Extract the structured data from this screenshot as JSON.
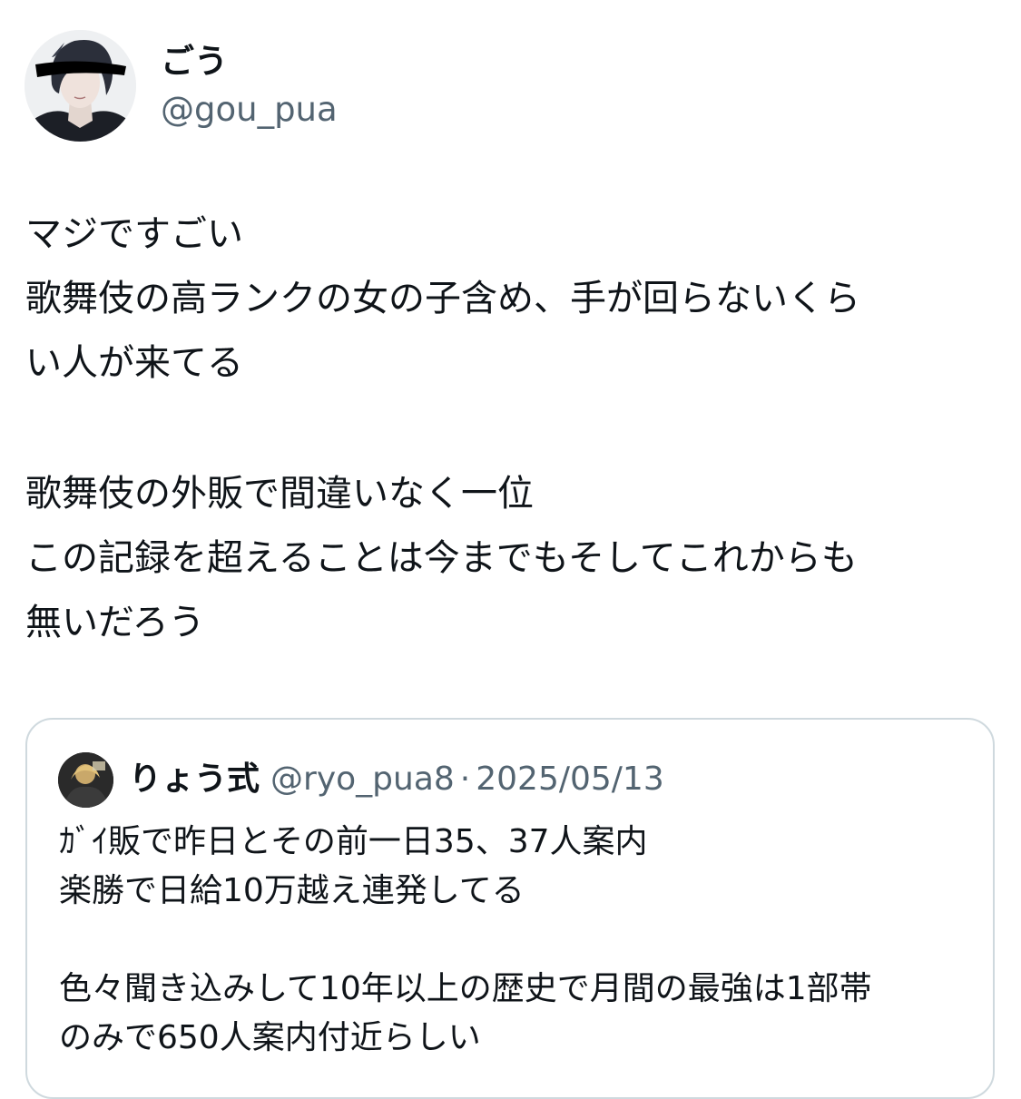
{
  "tweet": {
    "author": {
      "display_name": "ごう",
      "handle": "@gou_pua"
    },
    "text_lines": [
      "マジですごい",
      "歌舞伎の高ランクの女の子含め、手が回らないくら",
      "い人が来てる",
      "",
      "歌舞伎の外販で間違いなく一位",
      "この記録を超えることは今までもそしてこれからも",
      "無いだろう"
    ]
  },
  "quoted_tweet": {
    "author": {
      "display_name": "りょう式",
      "handle": "@ryo_pua8"
    },
    "separator": "·",
    "date": "2025/05/13",
    "text_lines": [
      "ｶﾞｲ販で昨日とその前一日35、37人案内",
      "楽勝で日給10万越え連発してる",
      "",
      "色々聞き込みして10年以上の歴史で月間の最強は1部帯",
      "のみで650人案内付近らしい"
    ]
  },
  "colors": {
    "text_primary": "#0f1419",
    "text_secondary": "#536471",
    "card_border": "#cfd9de",
    "background": "#ffffff"
  }
}
